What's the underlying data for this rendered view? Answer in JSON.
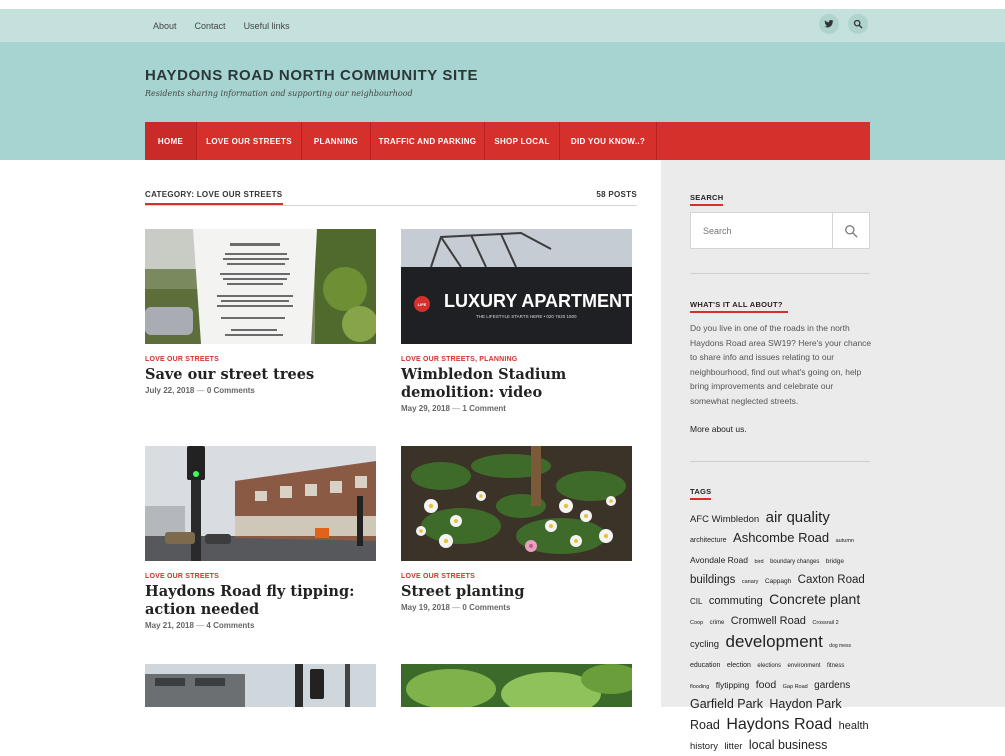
{
  "top_links": [
    "About",
    "Contact",
    "Useful links"
  ],
  "site": {
    "title": "HAYDONS ROAD NORTH COMMUNITY SITE",
    "description": "Residents sharing information and supporting our neighbourhood"
  },
  "nav": [
    "HOME",
    "LOVE OUR STREETS",
    "PLANNING",
    "TRAFFIC AND PARKING",
    "SHOP LOCAL",
    "DID YOU KNOW..?"
  ],
  "category": {
    "title": "CATEGORY: LOVE OUR STREETS",
    "count": "58 POSTS"
  },
  "posts": [
    {
      "category": "LOVE OUR STREETS",
      "title": "Save our street trees",
      "date": "July 22, 2018",
      "comments": "0 Comments",
      "image": "trees-need-water-sign"
    },
    {
      "category": "LOVE OUR STREETS, PLANNING",
      "title": "Wimbledon Stadium demolition: video",
      "date": "May 29, 2018",
      "comments": "1 Comment",
      "image": "luxury-apartments-hoarding",
      "image_text": "LUXURY APARTMENTS",
      "image_subtext": "THE LIFESTYLE STARTS HERE • 020 7620 1500",
      "image_badge": "LIFE"
    },
    {
      "category": "LOVE OUR STREETS",
      "title": "Haydons Road fly tipping: action needed",
      "date": "May 21, 2018",
      "comments": "4 Comments",
      "image": "street-with-traffic-lights"
    },
    {
      "category": "LOVE OUR STREETS",
      "title": "Street planting",
      "date": "May 19, 2018",
      "comments": "0 Comments",
      "image": "daisy-flower-bed"
    }
  ],
  "sidebar": {
    "search": {
      "heading": "SEARCH",
      "placeholder": "Search"
    },
    "about": {
      "heading": "WHAT'S IT ALL ABOUT?",
      "text": "Do you live in one of the roads in the north Haydons Road area SW19? Here's your chance to share info and issues relating to our neighbourhood, find out what's going on, help bring improvements and celebrate our somewhat neglected streets.",
      "link": "More about us."
    },
    "tags_heading": "TAGS",
    "tags": [
      {
        "name": "AFC Wimbledon",
        "size": 9.5
      },
      {
        "name": "air quality",
        "size": 15
      },
      {
        "name": "architecture",
        "size": 7
      },
      {
        "name": "Ashcombe Road",
        "size": 13
      },
      {
        "name": "autumn",
        "size": 5.5
      },
      {
        "name": "Avondale Road",
        "size": 8.5
      },
      {
        "name": "bird",
        "size": 5.5
      },
      {
        "name": "boundary changes",
        "size": 6
      },
      {
        "name": "bridge",
        "size": 6.5
      },
      {
        "name": "buildings",
        "size": 11.5
      },
      {
        "name": "canary",
        "size": 5.5
      },
      {
        "name": "Cappagh",
        "size": 6.5
      },
      {
        "name": "Caxton Road",
        "size": 11.5
      },
      {
        "name": "CIL",
        "size": 8
      },
      {
        "name": "commuting",
        "size": 11
      },
      {
        "name": "Concrete plant",
        "size": 14
      },
      {
        "name": "Coop",
        "size": 5.5
      },
      {
        "name": "crime",
        "size": 6
      },
      {
        "name": "Cromwell Road",
        "size": 11
      },
      {
        "name": "Crossrail 2",
        "size": 5.5
      },
      {
        "name": "cycling",
        "size": 9.5
      },
      {
        "name": "development",
        "size": 17
      },
      {
        "name": "dog mess",
        "size": 5
      },
      {
        "name": "education",
        "size": 7
      },
      {
        "name": "election",
        "size": 7
      },
      {
        "name": "elections",
        "size": 6
      },
      {
        "name": "environment",
        "size": 6
      },
      {
        "name": "fitness",
        "size": 6
      },
      {
        "name": "flooding",
        "size": 5.5
      },
      {
        "name": "flytipping",
        "size": 8.5
      },
      {
        "name": "food",
        "size": 10.5
      },
      {
        "name": "Gap Road",
        "size": 5.5
      },
      {
        "name": "gardens",
        "size": 10
      },
      {
        "name": "Garfield Park",
        "size": 12.5
      },
      {
        "name": "Haydon Park Road",
        "size": 12.5
      },
      {
        "name": "Haydons Road",
        "size": 16
      },
      {
        "name": "health",
        "size": 11
      },
      {
        "name": "history",
        "size": 9.5
      },
      {
        "name": "litter",
        "size": 9.5
      },
      {
        "name": "local business",
        "size": 12.5
      }
    ]
  },
  "colors": {
    "accent": "#d6302d",
    "header_bg": "#a6d5d1",
    "topbar_bg": "#c4e1de",
    "sidebar_bg": "#ebebeb"
  }
}
